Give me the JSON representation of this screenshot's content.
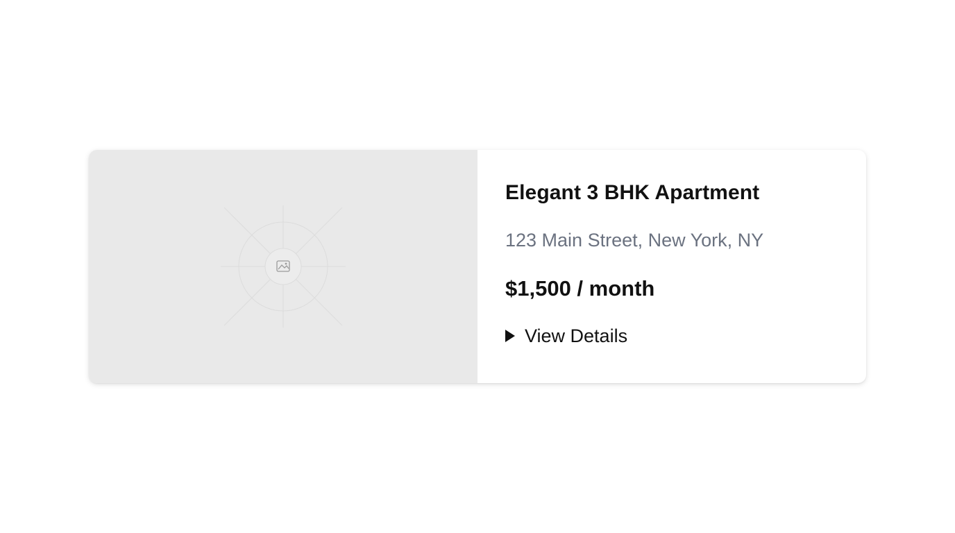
{
  "listing": {
    "image_icon": "image-placeholder-icon",
    "title": "Elegant 3 BHK Apartment",
    "address": "123 Main Street, New York, NY",
    "price": "$1,500 / month",
    "details_toggle": {
      "icon": "disclosure-triangle-icon",
      "label": "View Details"
    }
  },
  "colors": {
    "placeholder_bg": "#e9e9e9",
    "title": "#111111",
    "address": "#6b7280",
    "card_bg": "#ffffff"
  }
}
